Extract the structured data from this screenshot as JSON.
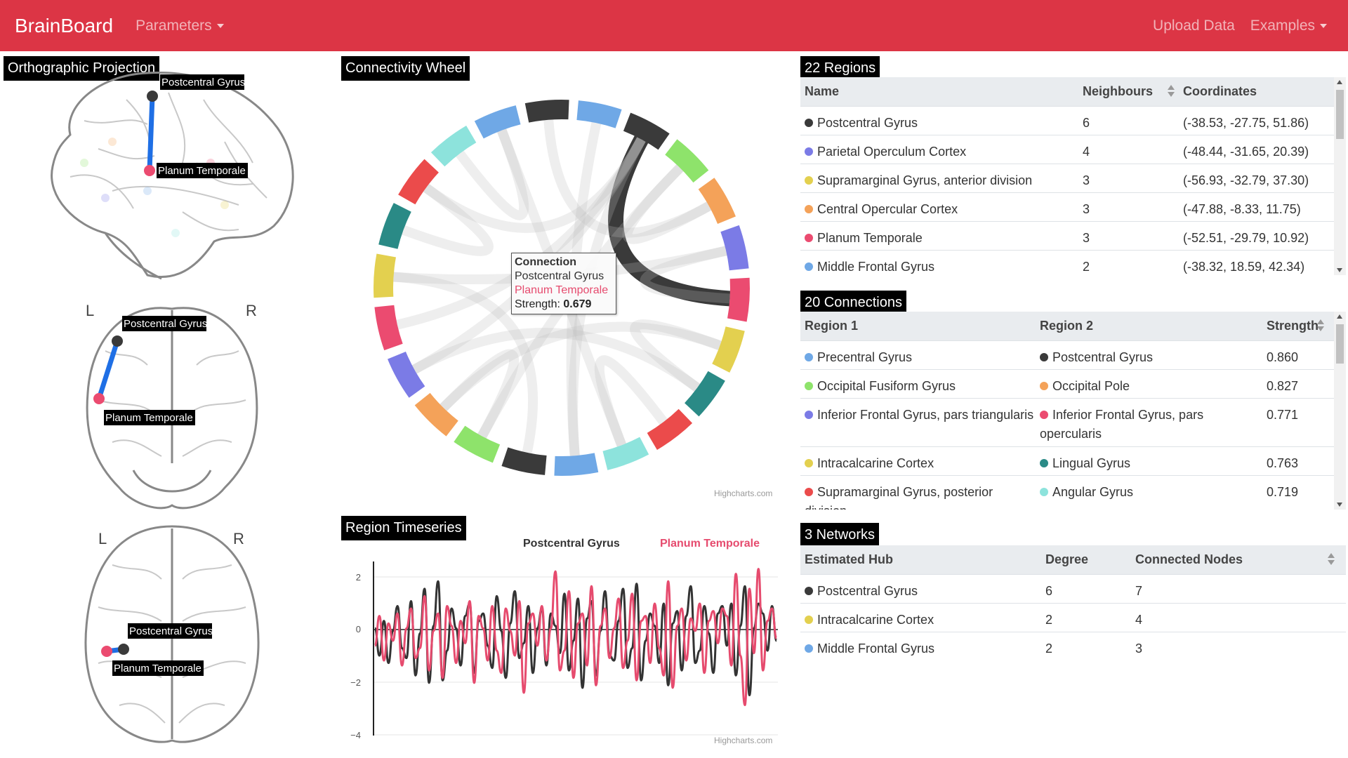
{
  "navbar": {
    "brand": "BrainBoard",
    "parameters": "Parameters",
    "upload": "Upload Data",
    "examples": "Examples"
  },
  "ortho": {
    "title": "Orthographic Projection",
    "node_a": "Postcentral Gyrus",
    "node_b": "Planum Temporale",
    "left_label": "L",
    "right_label": "R"
  },
  "wheel": {
    "title": "Connectivity Wheel",
    "credit": "Highcharts.com",
    "tooltip": {
      "title": "Connection",
      "from": "Postcentral Gyrus",
      "to": "Planum Temporale",
      "strength_label": "Strength:",
      "strength_value": "0.679"
    }
  },
  "timeseries": {
    "title": "Region Timeseries",
    "credit": "Highcharts.com"
  },
  "regions": {
    "title": "22 Regions",
    "headers": [
      "Name",
      "Neighbours",
      "Coordinates"
    ],
    "rows": [
      {
        "name": "Postcentral Gyrus",
        "color": "#3a3a3a",
        "neighbours": "6",
        "coords": "(-38.53, -27.75, 51.86)"
      },
      {
        "name": "Parietal Operculum Cortex",
        "color": "#7b7be6",
        "neighbours": "4",
        "coords": "(-48.44, -31.65, 20.39)"
      },
      {
        "name": "Supramarginal Gyrus, anterior division",
        "color": "#e3d04f",
        "neighbours": "3",
        "coords": "(-56.93, -32.79, 37.30)"
      },
      {
        "name": "Central Opercular Cortex",
        "color": "#f4a259",
        "neighbours": "3",
        "coords": "(-47.88, -8.33, 11.75)"
      },
      {
        "name": "Planum Temporale",
        "color": "#eb4b70",
        "neighbours": "3",
        "coords": "(-52.51, -29.79, 10.92)"
      },
      {
        "name": "Middle Frontal Gyrus",
        "color": "#6fa8e6",
        "neighbours": "2",
        "coords": "(-38.32, 18.59, 42.34)"
      }
    ]
  },
  "connections": {
    "title": "20 Connections",
    "headers": [
      "Region 1",
      "Region 2",
      "Strength"
    ],
    "rows": [
      {
        "r1": "Precentral Gyrus",
        "c1": "#6fa8e6",
        "r2": "Postcentral Gyrus",
        "c2": "#3a3a3a",
        "strength": "0.860"
      },
      {
        "r1": "Occipital Fusiform Gyrus",
        "c1": "#8ee36b",
        "r2": "Occipital Pole",
        "c2": "#f4a259",
        "strength": "0.827"
      },
      {
        "r1": "Inferior Frontal Gyrus, pars triangularis",
        "c1": "#7b7be6",
        "r2": "Inferior Frontal Gyrus, pars opercularis",
        "c2": "#eb4b70",
        "strength": "0.771"
      },
      {
        "r1": "Intracalcarine Cortex",
        "c1": "#e3d04f",
        "r2": "Lingual Gyrus",
        "c2": "#2a8a86",
        "strength": "0.763"
      },
      {
        "r1": "Supramarginal Gyrus, posterior division",
        "c1": "#eb4b4b",
        "r2": "Angular Gyrus",
        "c2": "#8de3dc",
        "strength": "0.719"
      }
    ]
  },
  "networks": {
    "title": "3 Networks",
    "headers": [
      "Estimated Hub",
      "Degree",
      "Connected Nodes"
    ],
    "rows": [
      {
        "hub": "Postcentral Gyrus",
        "color": "#3a3a3a",
        "degree": "6",
        "nodes": "7"
      },
      {
        "hub": "Intracalcarine Cortex",
        "color": "#e3d04f",
        "degree": "2",
        "nodes": "4"
      },
      {
        "hub": "Middle Frontal Gyrus",
        "color": "#6fa8e6",
        "degree": "2",
        "nodes": "3"
      }
    ]
  },
  "chart_data": [
    {
      "type": "line",
      "title": "",
      "xlabel": "",
      "ylabel": "",
      "ylim": [
        -4,
        3
      ],
      "yticks": [
        "2",
        "0",
        "−2",
        "−4"
      ],
      "series": [
        {
          "name": "Postcentral Gyrus",
          "color": "#333333",
          "values": [
            0.3,
            -0.8,
            0.6,
            -1.1,
            0.2,
            1.2,
            -0.5,
            -0.9,
            1.4,
            -1.6,
            0.1,
            1.9,
            -1.9,
            0.4,
            2.2,
            -1.8,
            -0.6,
            1.1,
            0.3,
            -1.2,
            0.8,
            1.3,
            -1.5,
            0.6,
            0.9,
            -0.4,
            -1.3,
            1.6,
            0.2,
            -1.7,
            0.5,
            1.8,
            -0.9,
            -0.3,
            1.2,
            -1.5,
            0.3,
            1.1,
            -1.2,
            0.9,
            0.4,
            -0.7,
            1.7,
            -1.4,
            -0.2,
            1.5,
            -2.1,
            0.7,
            1.4,
            -1.6,
            0.2,
            1.8,
            -0.8,
            -1.0,
            0.6,
            1.9,
            -1.3,
            -0.5,
            2.1,
            -1.8,
            -0.2,
            0.9,
            0.4,
            -1.1,
            1.3,
            -2.0,
            0.5,
            1.0,
            -1.4,
            0.8,
            2.0,
            -1.1,
            -0.6,
            1.2,
            0.1,
            -1.5,
            0.9,
            1.2,
            -0.4,
            1.3,
            -1.6,
            0.4,
            2.0,
            -2.4,
            0.3,
            1.3,
            0.9,
            -0.6,
            1.2,
            -0.2
          ]
        },
        {
          "name": "Planum Temporale",
          "color": "#e64b6e",
          "values": [
            -0.4,
            0.8,
            -1.0,
            0.5,
            -0.2,
            0.9,
            -1.2,
            0.3,
            1.1,
            -0.9,
            -0.5,
            1.6,
            -1.4,
            0.2,
            0.9,
            -1.7,
            1.2,
            0.4,
            -1.1,
            0.6,
            -0.3,
            1.4,
            -1.9,
            0.8,
            0.3,
            -1.0,
            1.2,
            -0.6,
            -1.5,
            1.1,
            0.2,
            -0.8,
            1.4,
            -2.3,
            0.5,
            0.9,
            -0.4,
            1.2,
            -1.0,
            0.3,
            2.6,
            -1.4,
            -0.6,
            1.8,
            -1.7,
            0.5,
            0.9,
            -1.2,
            2.0,
            -2.0,
            0.4,
            1.1,
            -0.9,
            0.3,
            1.5,
            -1.3,
            -0.2,
            1.7,
            -1.8,
            0.6,
            0.8,
            -1.1,
            1.3,
            -0.5,
            -1.6,
            2.2,
            -2.1,
            0.4,
            1.1,
            -1.0,
            0.7,
            0.2,
            1.3,
            -1.5,
            0.6,
            1.0,
            -0.3,
            1.1,
            0.8,
            -1.2,
            2.5,
            -0.8,
            -2.8,
            1.9,
            -0.7,
            2.7,
            -1.4,
            0.6,
            1.1,
            -0.1
          ]
        }
      ]
    },
    {
      "type": "chord",
      "title": "Connectivity Wheel",
      "segments": [
        {
          "color": "#3a3a3a"
        },
        {
          "color": "#8ee36b"
        },
        {
          "color": "#f4a259"
        },
        {
          "color": "#7b7be6"
        },
        {
          "color": "#eb4b70"
        },
        {
          "color": "#e3d04f"
        },
        {
          "color": "#2a8a86"
        },
        {
          "color": "#eb4b4b"
        },
        {
          "color": "#8de3dc"
        },
        {
          "color": "#6fa8e6"
        },
        {
          "color": "#3a3a3a"
        },
        {
          "color": "#8ee36b"
        },
        {
          "color": "#f4a259"
        },
        {
          "color": "#7b7be6"
        },
        {
          "color": "#eb4b70"
        },
        {
          "color": "#e3d04f"
        },
        {
          "color": "#2a8a86"
        },
        {
          "color": "#eb4b4b"
        },
        {
          "color": "#8de3dc"
        },
        {
          "color": "#6fa8e6"
        },
        {
          "color": "#3a3a3a"
        },
        {
          "color": "#6fa8e6"
        }
      ],
      "highlight": {
        "from": "Postcentral Gyrus",
        "to": "Planum Temporale",
        "strength": 0.679
      }
    }
  ]
}
